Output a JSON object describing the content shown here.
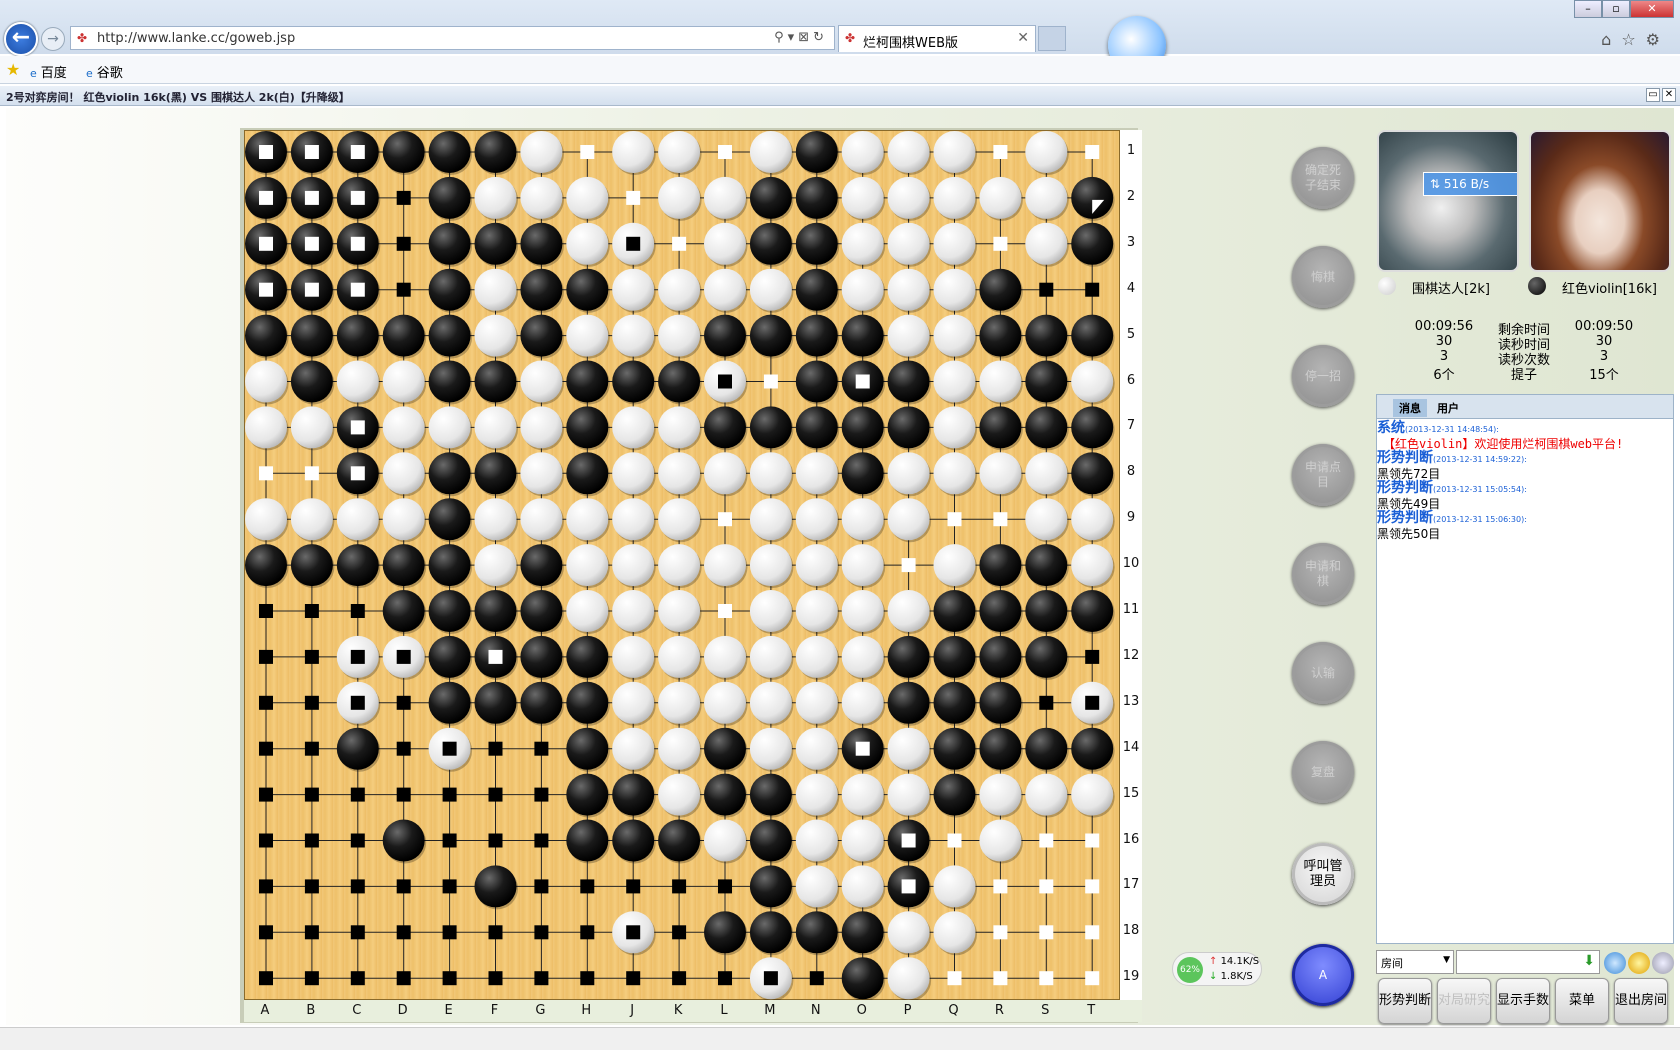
{
  "browser": {
    "url": "http://www.lanke.cc/goweb.jsp",
    "tab_title": "烂柯围棋WEB版",
    "favorites": [
      "百度",
      "谷歌"
    ]
  },
  "app": {
    "title": "2号对弈房间！  红色violin 16k(黑) VS 围棋达人 2k(白)【升降级】"
  },
  "board": {
    "size": 19,
    "columns": [
      "A",
      "B",
      "C",
      "D",
      "E",
      "F",
      "G",
      "H",
      "J",
      "K",
      "L",
      "M",
      "N",
      "O",
      "P",
      "Q",
      "R",
      "S",
      "T"
    ],
    "rows_top_to_bottom": [
      "1",
      "2",
      "3",
      "4",
      "5",
      "6",
      "7",
      "8",
      "9",
      "10",
      "11",
      "12",
      "13",
      "14",
      "15",
      "16",
      "17",
      "18",
      "19"
    ],
    "position": [
      "bbbBBBW.WW.WBWWW.W.",
      "bbb.BWWW.WWBBWWWWWB",
      "bbb.BBBWw.WBBWWW.WB",
      "bbb.BWBBWWWWBWWWB..",
      "BBBBBWBWWWBBBBWWBBB",
      "WBWWBBWBBBw.BbBWWBW",
      "WWbWWWWBWWBBBBBWBBB",
      "..bWBBWBWWWWWBWWWWB",
      "WWWWBWWWWW.WWWW..WW",
      "BBBBBWBWWWWWWW.WBBW",
      "...BBBBWWW.WWWWBBBB",
      "..wwBbBBWWWWWWBBBB.",
      "..w.BBBBWWWWWWBBB.w",
      "..B.w..BWWBWWbWBBBB",
      ".......BBWBBWWWBWWW",
      "...B...BBBWBWWb.W..",
      ".....B.....BWWbW...",
      "........w.BBBBWW...",
      "...........w.BW...."
    ],
    "territory_black_markers": 96,
    "territory_white_markers": 40,
    "last_move": "T2"
  },
  "controls": {
    "confirm_dead": "确定死子结束",
    "resign": "悔棋",
    "pass": "停一招",
    "request_count": "申请点目",
    "request_draw": "申请和棋",
    "give_up": "认输",
    "replay": "复盘",
    "call_admin": "呼叫管理员",
    "avatar_a": "A"
  },
  "network": {
    "percent": "62%",
    "up": "14.1K/S",
    "down": "1.8K/S",
    "badge": "516 B/s"
  },
  "players": {
    "white": {
      "name": "围棋达人[2k]",
      "time_left": "00:09:56",
      "byoyomi_sec": "30",
      "byoyomi_count": "3",
      "captures": "6个"
    },
    "black": {
      "name": "红色violin[16k]",
      "time_left": "00:09:50",
      "byoyomi_sec": "30",
      "byoyomi_count": "3",
      "captures": "15个"
    },
    "labels": {
      "time_left": "剩余时间",
      "byoyomi_sec": "读秒时间",
      "byoyomi_count": "读秒次数",
      "captures": "提子"
    }
  },
  "chat": {
    "tabs": [
      "消息",
      "用户"
    ],
    "messages": [
      {
        "sender": "系统",
        "time": "(2013-12-31 14:48:54):",
        "text": "【红色violin】欢迎使用烂柯围棋web平台!"
      },
      {
        "sender": "形势判断",
        "time": "(2013-12-31 14:59:22):",
        "text": "黑领先72目"
      },
      {
        "sender": "形势判断",
        "time": "(2013-12-31 15:05:54):",
        "text": "黑领先49目"
      },
      {
        "sender": "形势判断",
        "time": "(2013-12-31 15:06:30):",
        "text": "黑领先50目"
      }
    ],
    "room_select": "房间"
  },
  "bottom_buttons": {
    "judge": "形势判断",
    "research": "对局研究",
    "show_moves": "显示手数",
    "menu": "菜单",
    "exit_room": "退出房间"
  },
  "colors": {
    "board": "#efc372",
    "black_stone": "#1a1a1a",
    "white_stone": "#f4f4f4",
    "chat_sender": "#1a5fd6",
    "chat_red": "#e00000"
  }
}
